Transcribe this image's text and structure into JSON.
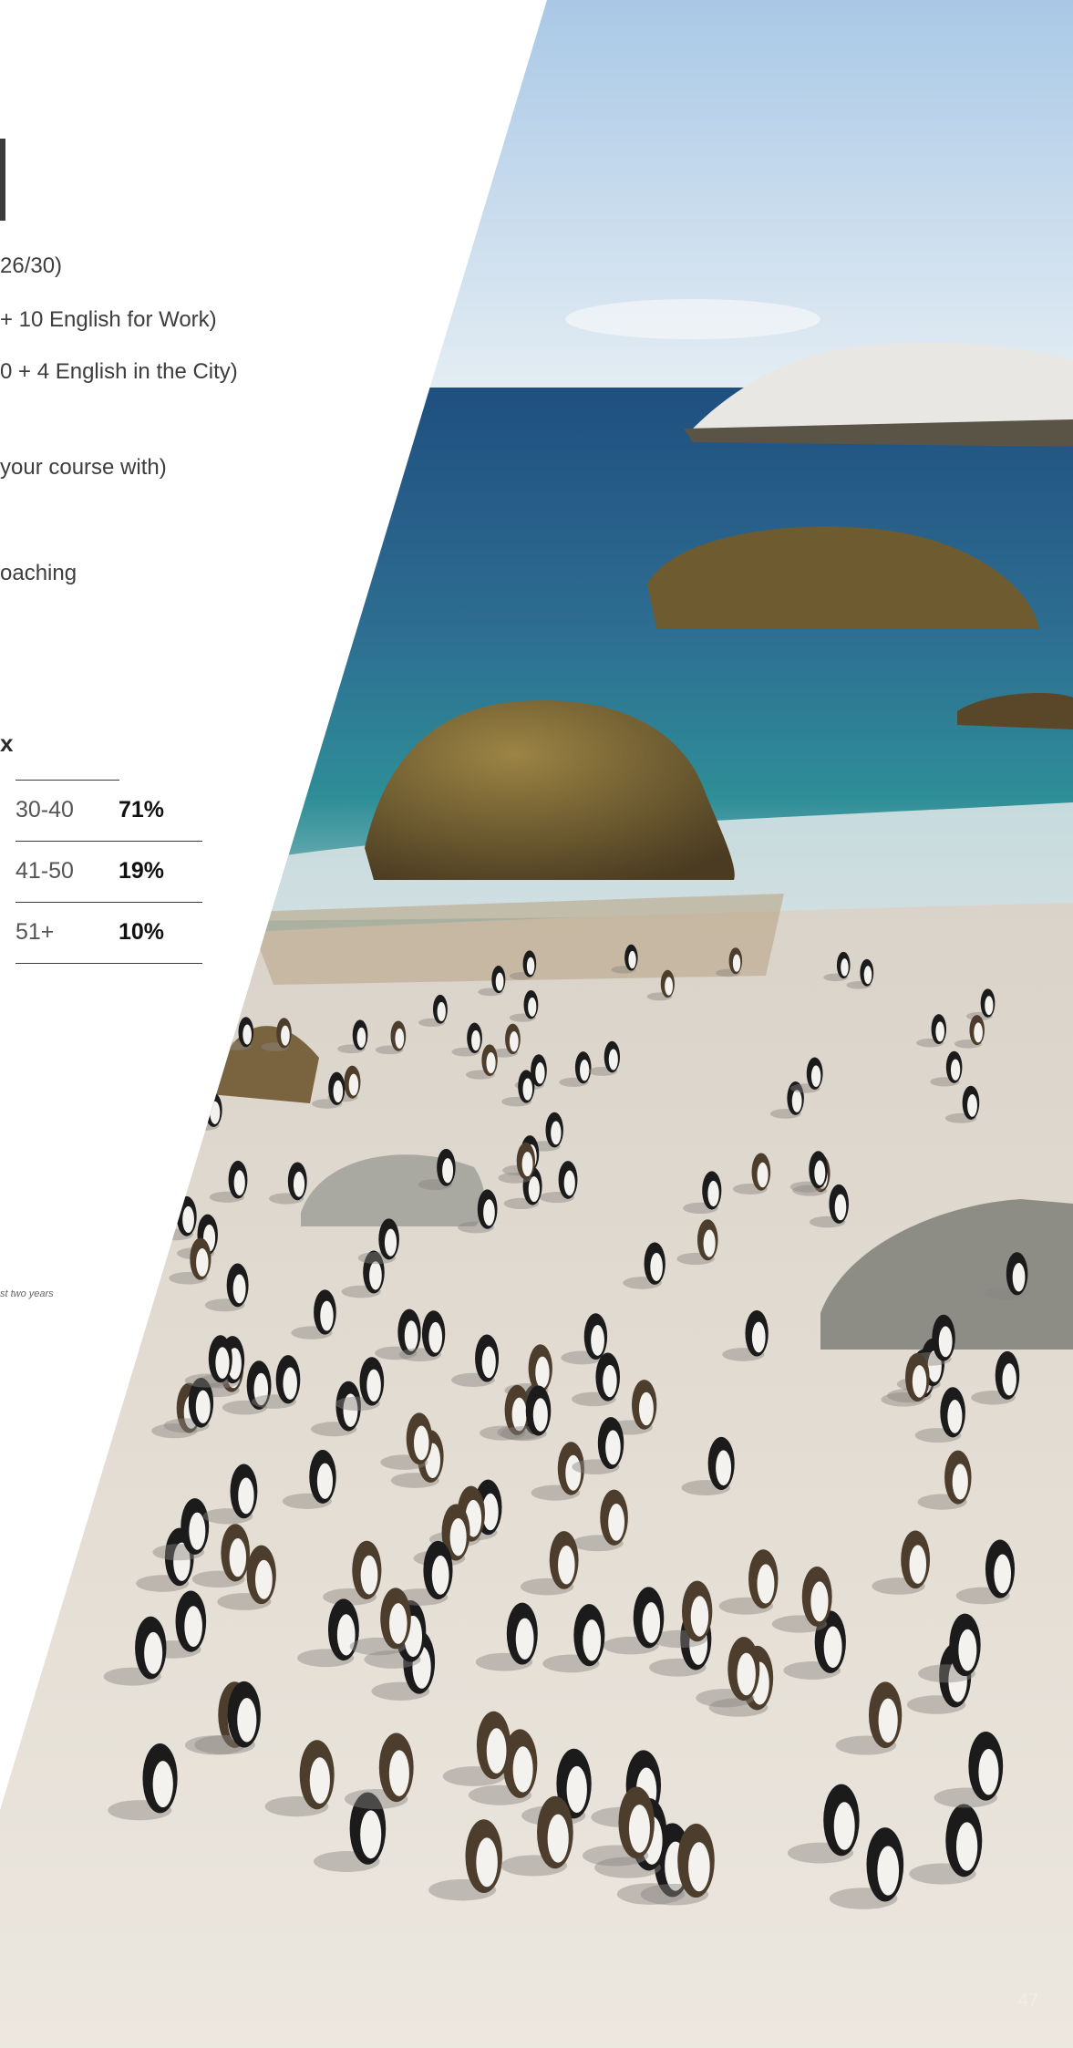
{
  "course_lines": [
    {
      "text": "26/30)"
    },
    {
      "text": "+ 10 English for Work)"
    },
    {
      "text": "0 + 4 English in the City)"
    },
    {
      "text": "your course with)"
    },
    {
      "text": "oaching"
    }
  ],
  "age_heading": "x",
  "age_table": [
    {
      "range": "30-40",
      "percent": "71%"
    },
    {
      "range": "41-50",
      "percent": "19%"
    },
    {
      "range": "51+",
      "percent": "10%"
    }
  ],
  "footnote": "st two years",
  "page_number": "47",
  "colors": {
    "sky": "#cfe0ee",
    "sea": "#2f6d9a",
    "sand": "#e7e1d8",
    "rock": "#6b5a34"
  }
}
